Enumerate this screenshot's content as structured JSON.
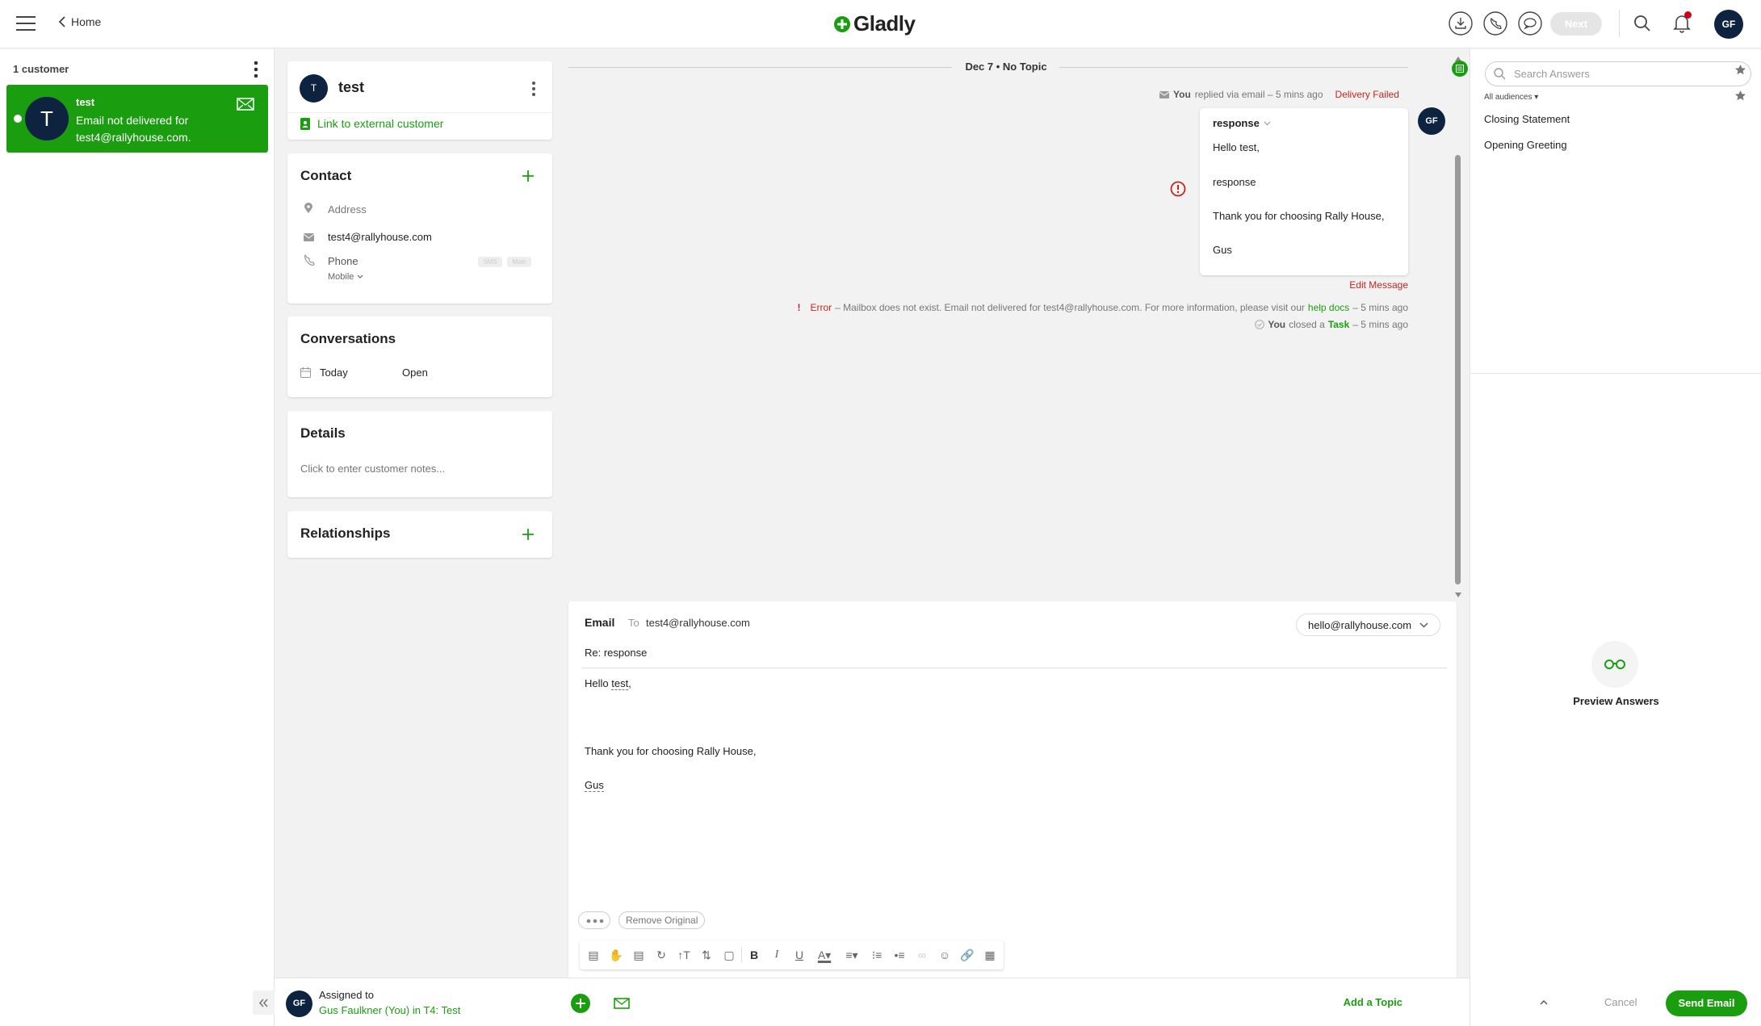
{
  "header": {
    "home_label": "Home",
    "brand": "Gladly",
    "next_label": "Next",
    "avatar_initials": "GF",
    "accent": "#1a9e0f",
    "notification_color": "#d0021b"
  },
  "inbox": {
    "count_label": "1 customer",
    "item": {
      "initial": "T",
      "name": "test",
      "preview": "Email not delivered for test4@rallyhouse.com.",
      "bg": "#1a9e0f"
    }
  },
  "profile": {
    "initial": "T",
    "name": "test",
    "link_label": "Link to external customer"
  },
  "contact": {
    "title": "Contact",
    "address_placeholder": "Address",
    "email": "test4@rallyhouse.com",
    "phone_placeholder": "Phone",
    "phone_type": "Mobile",
    "sms_badge": "SMS",
    "main_badge": "Main"
  },
  "conversations": {
    "title": "Conversations",
    "date": "Today",
    "status": "Open"
  },
  "details": {
    "title": "Details",
    "placeholder": "Click to enter customer notes..."
  },
  "relationships": {
    "title": "Relationships"
  },
  "timeline": {
    "topic_header": "Dec 7 • No Topic",
    "reply_prefix": "You",
    "reply_meta": "replied via email – 5 mins ago",
    "delivery_status": "Delivery Failed",
    "message": {
      "subject": "response",
      "lines": [
        "Hello test,",
        "response",
        "Thank you for choosing Rally House,",
        "Gus"
      ]
    },
    "agent_initials": "GF",
    "edit_label": "Edit Message",
    "error_label": "Error",
    "error_text": "– Mailbox does not exist. Email not delivered for test4@rallyhouse.com. For more information, please visit our",
    "error_link": "help docs",
    "error_time": "– 5 mins ago",
    "task_you": "You",
    "task_mid": "closed a",
    "task_word": "Task",
    "task_time": "– 5 mins ago"
  },
  "composer": {
    "channel": "Email",
    "to_label": "To",
    "to_value": "test4@rallyhouse.com",
    "from_value": "hello@rallyhouse.com",
    "subject": "Re: response",
    "body": {
      "greet_a": "Hello ",
      "greet_b": "test",
      ",": ",",
      "thanks": "Thank you for choosing Rally House,",
      "sign": "Gus"
    },
    "remove_original": "Remove Original"
  },
  "footer": {
    "assigned_label": "Assigned to",
    "assignee": "Gus Faulkner (You) in T4: Test",
    "add_topic": "Add a Topic",
    "cancel": "Cancel",
    "send": "Send Email",
    "avatar_initials": "GF"
  },
  "answers": {
    "search_placeholder": "Search Answers",
    "audience": "All audiences",
    "items": [
      "Closing Statement",
      "Opening Greeting"
    ],
    "preview_label": "Preview Answers"
  }
}
